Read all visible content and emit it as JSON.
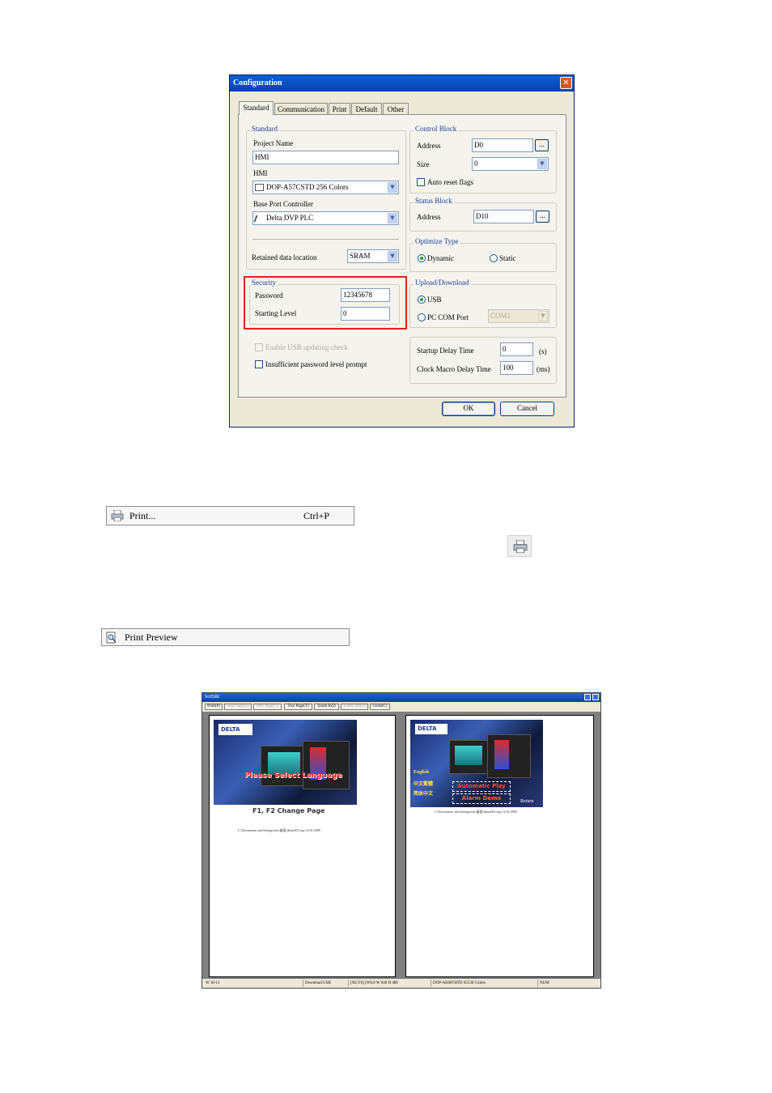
{
  "dialog": {
    "title": "Configuration",
    "close_glyph": "✕",
    "tabs": [
      "Standard",
      "Communication",
      "Print",
      "Default",
      "Other"
    ],
    "active_tab": "Standard",
    "standard": {
      "legend": "Standard",
      "project_name_label": "Project Name",
      "project_name_value": "HMI",
      "hmi_label": "HMI",
      "hmi_value": "DOP-A57CSTD 256 Colors",
      "base_port_label": "Base Port Controller",
      "base_port_value": "Delta DVP PLC",
      "retained_label": "Retained data location",
      "retained_value": "SRAM"
    },
    "security": {
      "legend": "Security",
      "password_label": "Password",
      "password_value": "12345678",
      "starting_level_label": "Starting Level",
      "starting_level_value": "0"
    },
    "enable_usb_label": "Enable USB updating check",
    "insufficient_label": "Insufficient password level prompt",
    "control_block": {
      "legend": "Control Block",
      "address_label": "Address",
      "address_value": "D0",
      "size_label": "Size",
      "size_value": "0",
      "auto_reset_label": "Auto reset flags"
    },
    "status_block": {
      "legend": "Status Block",
      "address_label": "Address",
      "address_value": "D10"
    },
    "optimize": {
      "legend": "Optimize Type",
      "dynamic_label": "Dynamic",
      "static_label": "Static",
      "selected": "Dynamic"
    },
    "upload": {
      "legend": "Upload/Download",
      "usb_label": "USB",
      "pc_com_label": "PC COM Port",
      "com_value": "COM1",
      "selected": "USB"
    },
    "startup": {
      "startup_label": "Startup Delay Time",
      "startup_value": "0",
      "startup_unit": "(s)",
      "clock_label": "Clock Macro Delay Time",
      "clock_value": "100",
      "clock_unit": "(ms)"
    },
    "ellipsis": "...",
    "ok_label": "OK",
    "cancel_label": "Cancel"
  },
  "menu_print": {
    "label": "Print...",
    "shortcut": "Ctrl+P"
  },
  "menu_preview": {
    "label": "Print Preview"
  },
  "preview": {
    "title": "ScrEdit",
    "toolbar": [
      "Print(P)",
      "Next Page(N)",
      "Prev Page(V)",
      "Two Page(T)",
      "Zoom In(I)",
      "Zoom Out(O)",
      "Close(C)"
    ],
    "disabled_toolbar": [
      "Next Page(N)",
      "Prev Page(V)",
      "Zoom Out(O)"
    ],
    "page1": {
      "brand": "DELTA",
      "headline": "Please Select Language",
      "footer_text": "F1, F2 Change Page",
      "caption": "C:\\Documents and Settings\\test\\桌面\\demo001.dop 12/01/2009"
    },
    "page2": {
      "brand": "DELTA",
      "lang1": "English",
      "lang2": "中文繁體",
      "lang3": "简体中文",
      "auto": "Automatic Play",
      "alarm": "Alarm Demo",
      "return": "Return",
      "caption": "C:\\Documents and Settings\\test\\桌面\\demo001.dop 12/01/2009"
    },
    "status": [
      "W 10-11",
      "Download USB",
      "[X0,Y0] (W0,0 W 640 H 480",
      "DOP-AE80THTD 65536 Colors",
      "NUM"
    ]
  }
}
